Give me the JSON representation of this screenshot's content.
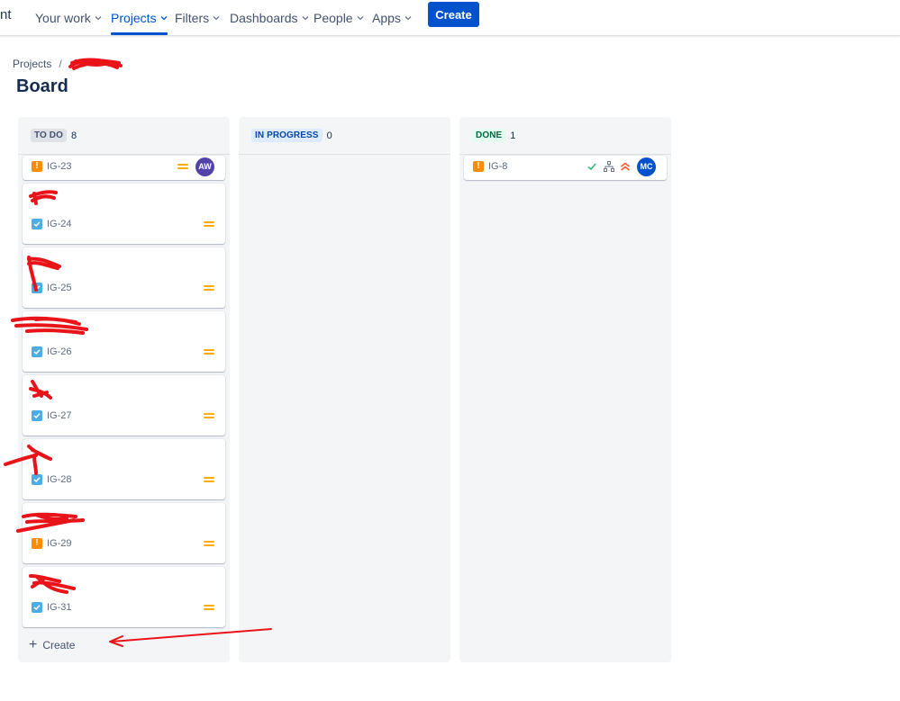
{
  "nav": {
    "logo_fragment": "nt",
    "items": [
      {
        "label": "Your work"
      },
      {
        "label": "Projects"
      },
      {
        "label": "Filters"
      },
      {
        "label": "Dashboards"
      },
      {
        "label": "People"
      },
      {
        "label": "Apps"
      }
    ],
    "create_label": "Create"
  },
  "breadcrumb": {
    "root": "Projects",
    "separator": "/"
  },
  "page_title": "Board",
  "columns": [
    {
      "status": "TO DO",
      "count": "8",
      "cards": [
        {
          "key": "IG-23",
          "type": "bug",
          "priority": "medium",
          "assignee": "AW"
        },
        {
          "key": "IG-24",
          "type": "story",
          "priority": "medium"
        },
        {
          "key": "IG-25",
          "type": "story",
          "priority": "medium"
        },
        {
          "key": "IG-26",
          "type": "story",
          "priority": "medium"
        },
        {
          "key": "IG-27",
          "type": "story",
          "priority": "medium"
        },
        {
          "key": "IG-28",
          "type": "story",
          "priority": "medium"
        },
        {
          "key": "IG-29",
          "type": "bug",
          "priority": "medium"
        },
        {
          "key": "IG-31",
          "type": "story",
          "priority": "medium"
        }
      ],
      "create_label": "Create"
    },
    {
      "status": "IN PROGRESS",
      "count": "0",
      "cards": []
    },
    {
      "status": "DONE",
      "count": "1",
      "cards": [
        {
          "key": "IG-8",
          "type": "bug",
          "priority": "highest",
          "assignee": "MC",
          "icons": [
            "check-icon",
            "subtask-icon",
            "priority-highest-icon"
          ]
        }
      ]
    }
  ],
  "colors": {
    "accent": "#0052cc",
    "redaction": "#e8141a",
    "avatar_aw": "#5243aa",
    "avatar_mc": "#0052cc"
  }
}
